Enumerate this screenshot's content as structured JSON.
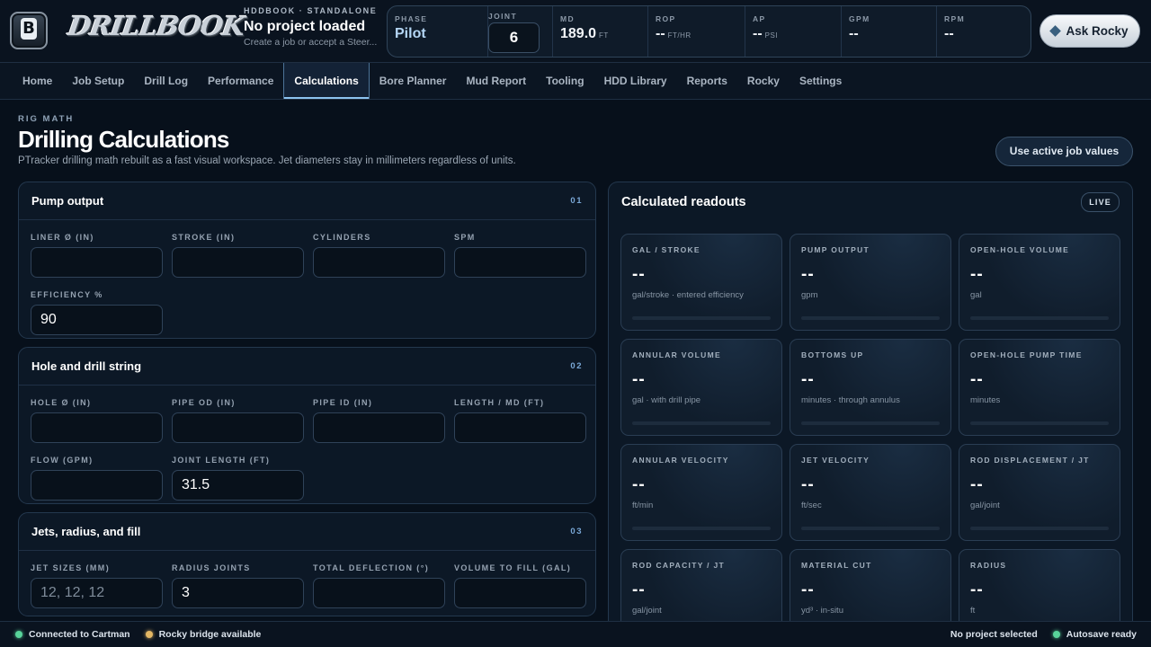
{
  "brand": {
    "badge_letter": "B",
    "wordmark": "DRILLBOOK"
  },
  "project": {
    "kicker": "HDDBOOK · STANDALONE",
    "title": "No project loaded",
    "subtitle": "Create a job or accept a Steer..."
  },
  "metrics": [
    {
      "label": "PHASE",
      "value": "Pilot",
      "unit": ""
    },
    {
      "label": "JOINT",
      "value": "6",
      "unit": ""
    },
    {
      "label": "MD",
      "value": "189.0",
      "unit": "FT"
    },
    {
      "label": "ROP",
      "value": "--",
      "unit": "FT/HR"
    },
    {
      "label": "AP",
      "value": "--",
      "unit": "PSI"
    },
    {
      "label": "GPM",
      "value": "--",
      "unit": ""
    },
    {
      "label": "RPM",
      "value": "--",
      "unit": ""
    }
  ],
  "ask_button": {
    "label": "Ask Rocky",
    "icon": "diamond-icon"
  },
  "nav": {
    "tabs": [
      "Home",
      "Job Setup",
      "Drill Log",
      "Performance",
      "Calculations",
      "Bore Planner",
      "Mud Report",
      "Tooling",
      "HDD Library",
      "Reports",
      "Rocky",
      "Settings"
    ],
    "active": "Calculations"
  },
  "page": {
    "kicker": "RIG MATH",
    "title": "Drilling Calculations",
    "subtitle": "PTracker drilling math rebuilt as a fast visual workspace. Jet diameters stay in millimeters regardless of units.",
    "use_button": "Use active job values"
  },
  "sections": [
    {
      "title": "Pump output",
      "number": "01",
      "fields": [
        {
          "label": "LINER Ø (IN)",
          "value": "",
          "placeholder": ""
        },
        {
          "label": "STROKE (IN)",
          "value": "",
          "placeholder": ""
        },
        {
          "label": "CYLINDERS",
          "value": "",
          "placeholder": ""
        },
        {
          "label": "SPM",
          "value": "",
          "placeholder": ""
        },
        {
          "label": "EFFICIENCY %",
          "value": "90",
          "placeholder": ""
        }
      ]
    },
    {
      "title": "Hole and drill string",
      "number": "02",
      "fields": [
        {
          "label": "HOLE Ø (IN)",
          "value": "",
          "placeholder": ""
        },
        {
          "label": "PIPE OD (IN)",
          "value": "",
          "placeholder": ""
        },
        {
          "label": "PIPE ID (IN)",
          "value": "",
          "placeholder": ""
        },
        {
          "label": "LENGTH / MD (FT)",
          "value": "",
          "placeholder": ""
        },
        {
          "label": "FLOW (GPM)",
          "value": "",
          "placeholder": ""
        },
        {
          "label": "JOINT LENGTH (FT)",
          "value": "31.5",
          "placeholder": ""
        }
      ]
    },
    {
      "title": "Jets, radius, and fill",
      "number": "03",
      "fields": [
        {
          "label": "JET SIZES (MM)",
          "value": "",
          "placeholder": "12, 12, 12"
        },
        {
          "label": "RADIUS JOINTS",
          "value": "3",
          "placeholder": ""
        },
        {
          "label": "TOTAL DEFLECTION (°)",
          "value": "",
          "placeholder": ""
        },
        {
          "label": "VOLUME TO FILL (GAL)",
          "value": "",
          "placeholder": ""
        }
      ]
    }
  ],
  "readouts": {
    "title": "Calculated readouts",
    "badge": "LIVE",
    "tiles": [
      {
        "label": "GAL / STROKE",
        "value": "--",
        "unit": "gal/stroke · entered efficiency"
      },
      {
        "label": "PUMP OUTPUT",
        "value": "--",
        "unit": "gpm"
      },
      {
        "label": "OPEN-HOLE VOLUME",
        "value": "--",
        "unit": "gal"
      },
      {
        "label": "ANNULAR VOLUME",
        "value": "--",
        "unit": "gal · with drill pipe"
      },
      {
        "label": "BOTTOMS UP",
        "value": "--",
        "unit": "minutes · through annulus"
      },
      {
        "label": "OPEN-HOLE PUMP TIME",
        "value": "--",
        "unit": "minutes"
      },
      {
        "label": "ANNULAR VELOCITY",
        "value": "--",
        "unit": "ft/min"
      },
      {
        "label": "JET VELOCITY",
        "value": "--",
        "unit": "ft/sec"
      },
      {
        "label": "ROD DISPLACEMENT / JT",
        "value": "--",
        "unit": "gal/joint"
      },
      {
        "label": "ROD CAPACITY / JT",
        "value": "--",
        "unit": "gal/joint"
      },
      {
        "label": "MATERIAL CUT",
        "value": "--",
        "unit": "yd³ · in-situ"
      },
      {
        "label": "RADIUS",
        "value": "--",
        "unit": "ft"
      }
    ]
  },
  "status": {
    "left": [
      {
        "label": "Connected to Cartman",
        "color": "#58d39a"
      },
      {
        "label": "Rocky bridge available",
        "color": "#e3b764"
      }
    ],
    "right": [
      {
        "label": "No project selected"
      },
      {
        "label": "Autosave ready",
        "color": "#58d39a"
      }
    ]
  }
}
